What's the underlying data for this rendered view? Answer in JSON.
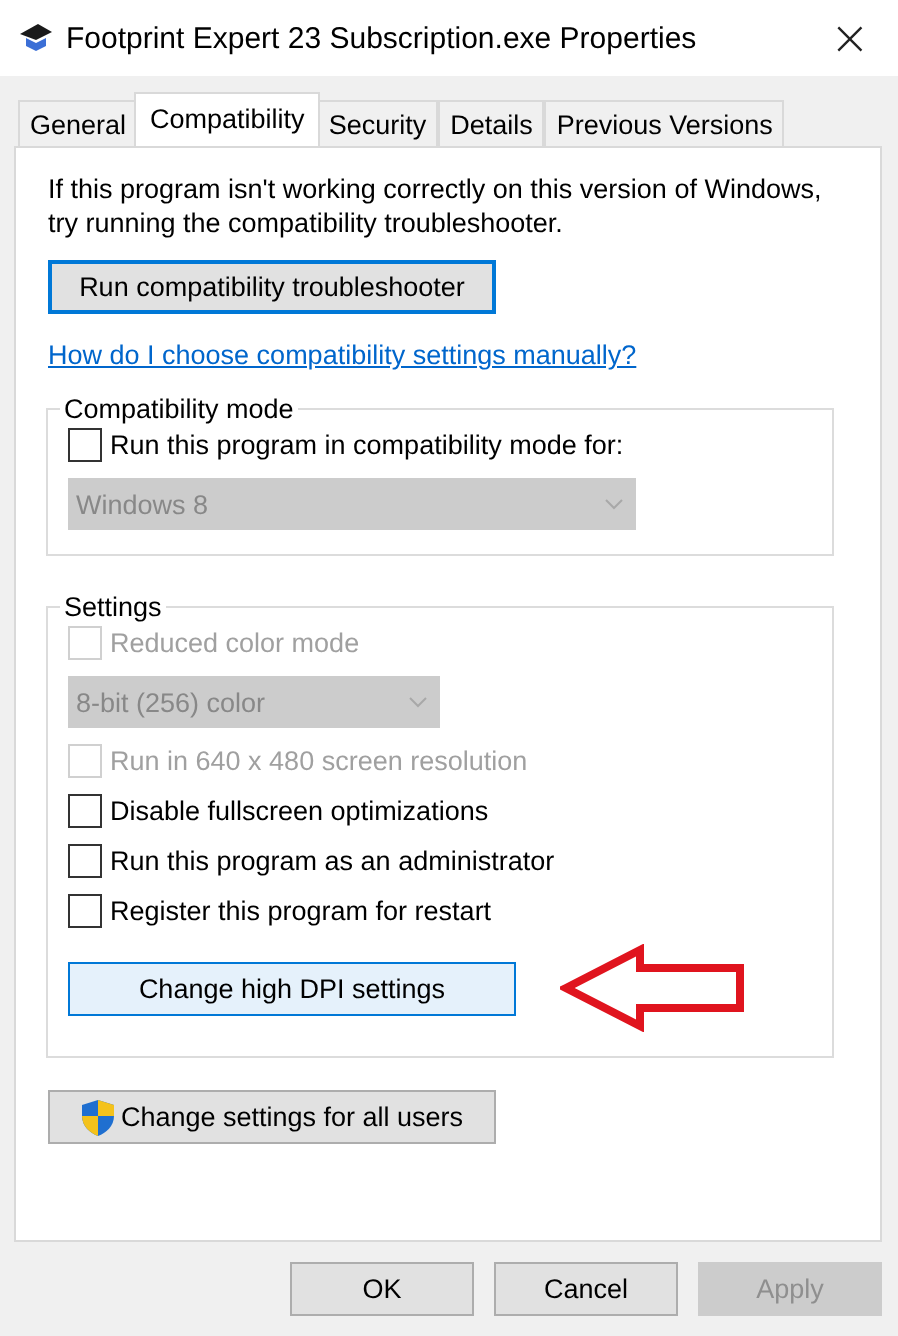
{
  "window": {
    "title": "Footprint Expert 23 Subscription.exe Properties",
    "close": "×"
  },
  "tabs": [
    {
      "label": "General",
      "selected": false
    },
    {
      "label": "Compatibility",
      "selected": true
    },
    {
      "label": "Security",
      "selected": false
    },
    {
      "label": "Details",
      "selected": false
    },
    {
      "label": "Previous Versions",
      "selected": false
    }
  ],
  "intro": "If this program isn't working correctly on this version of Windows, try running the compatibility troubleshooter.",
  "troubleshooter_button": "Run compatibility troubleshooter",
  "help_link": "How do I choose compatibility settings manually?",
  "compatibility_mode": {
    "title": "Compatibility mode",
    "items": [
      {
        "kind": "checkbox",
        "label": "Run this program in compatibility mode for:",
        "checked": false,
        "disabled": false
      },
      {
        "kind": "dropdown",
        "value": "Windows 8",
        "disabled": true,
        "wide": true
      }
    ]
  },
  "settings": {
    "title": "Settings",
    "items": [
      {
        "kind": "checkbox",
        "label": "Reduced color mode",
        "checked": false,
        "disabled": true
      },
      {
        "kind": "dropdown",
        "value": "8-bit (256) color",
        "disabled": true,
        "wide": false
      },
      {
        "kind": "checkbox",
        "label": "Run in 640 x 480 screen resolution",
        "checked": false,
        "disabled": true
      },
      {
        "kind": "checkbox",
        "label": "Disable fullscreen optimizations",
        "checked": false,
        "disabled": false
      },
      {
        "kind": "checkbox",
        "label": "Run this program as an administrator",
        "checked": false,
        "disabled": false
      },
      {
        "kind": "checkbox",
        "label": "Register this program for restart",
        "checked": false,
        "disabled": false
      },
      {
        "kind": "button",
        "label": "Change high DPI settings",
        "highlighted": true
      }
    ]
  },
  "all_users_button": "Change settings for all users",
  "dialog_buttons": [
    {
      "label": "OK",
      "disabled": false
    },
    {
      "label": "Cancel",
      "disabled": false
    },
    {
      "label": "Apply",
      "disabled": true
    }
  ]
}
